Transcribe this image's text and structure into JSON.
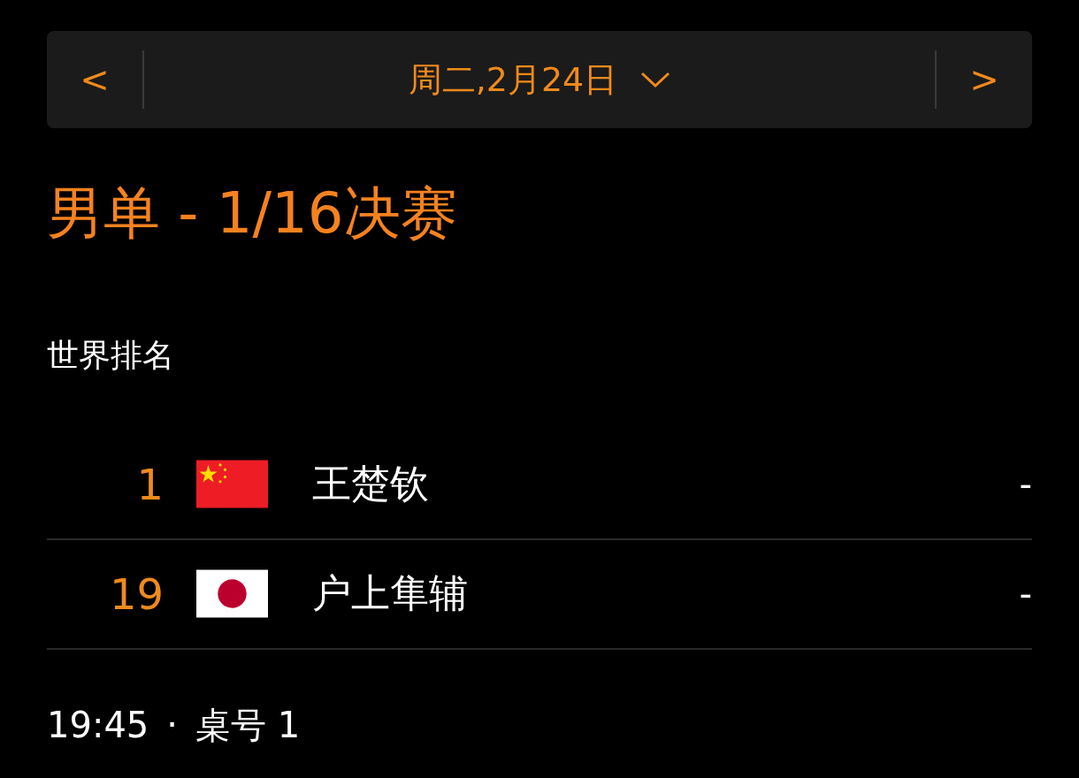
{
  "date_bar": {
    "prev": "<",
    "date": "周二,2月24日",
    "next": ">"
  },
  "title": "男单 - 1/16决赛",
  "section_label": "世界排名",
  "players": [
    {
      "rank": "1",
      "kind": "china",
      "name": "王楚钦",
      "score": "-"
    },
    {
      "rank": "19",
      "kind": "japan",
      "name": "户上隼辅",
      "score": "-"
    }
  ],
  "footer": {
    "time": "19:45",
    "separator": "·",
    "table": "桌号 1"
  }
}
